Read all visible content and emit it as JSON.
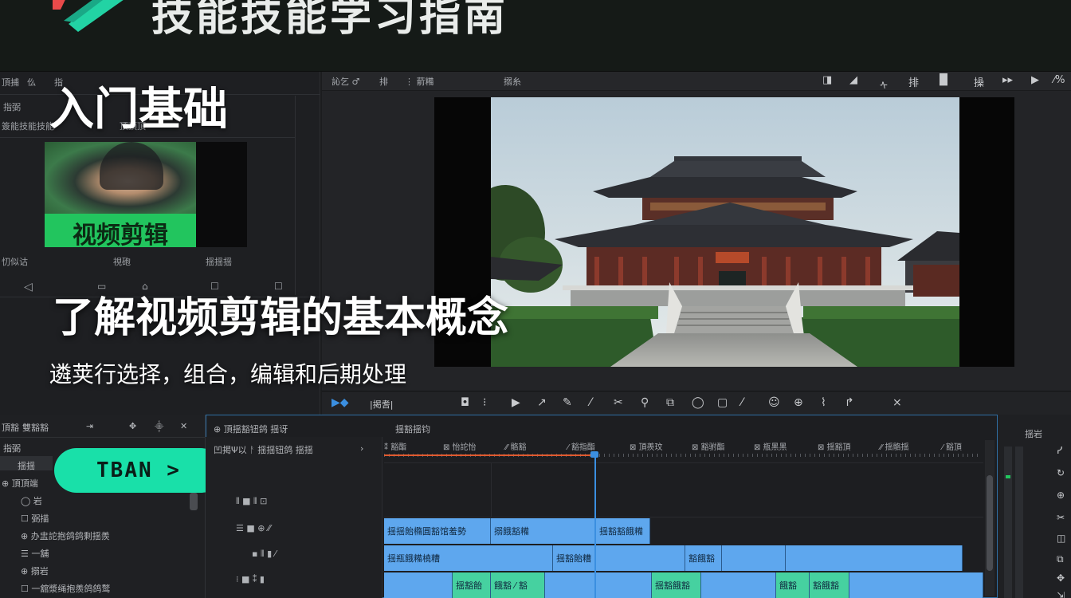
{
  "banner": {
    "title": "技能技能学习指南"
  },
  "left_panel": {
    "tabs": [
      "頂捕",
      "仫",
      "指"
    ],
    "rows": [
      "指弼",
      "簽能技能技能",
      "頂頂頂"
    ],
    "thumb_labels": [
      "忉似诂",
      "視砲",
      "揺揺揺"
    ],
    "thumb_caption": "视频剪辑",
    "controls": [
      "◁",
      "▭",
      "⌂",
      "☐",
      "☐"
    ]
  },
  "overlay": {
    "heading_basics": "入门基础",
    "heading_concept": "了解视频剪辑的基本概念",
    "subtext": "遴荚行选择，组合，编辑和后期处理",
    "cta_label": "TBAN >"
  },
  "preview": {
    "toolbar_left": [
      "訫乞 ♂",
      "排",
      "⋮ 葥糒",
      "搦糸"
    ],
    "toolbar_right_icons": [
      "◨",
      "◢",
      "ᠰ",
      "排",
      "▐▌",
      "操",
      "▸▸",
      "▶",
      "⁄%"
    ]
  },
  "timeline_toolbar": {
    "left": "▶◆",
    "label": "|掲䎛|",
    "tools": [
      "◘",
      "⁝",
      "▶",
      "↗",
      "✎",
      "⁄",
      "✂",
      "⚲",
      "⧉",
      "◯",
      "▢",
      "⁄",
      "☺",
      "⊕",
      "⌇",
      "↱",
      "⨯"
    ]
  },
  "bottom_left": {
    "header": [
      "頂豁",
      "雙豁豁",
      "⇥",
      "✥",
      "⸎",
      "✕"
    ],
    "rows": [
      "指弼",
      "揺揺",
      "⊕ 頂頂端",
      "◯ 岩",
      "☐ 弼描",
      "⊕ 办盅詑抱鸽鸽剩揺羨",
      "☰ 一舖",
      "⊕ 搦岩",
      "☐ 一舘漿绳抱羨鸽鸽鹜"
    ]
  },
  "timeline": {
    "header_left": "⊕ 頂揺豁钮鸽 揺讶",
    "header_right": "揺豁揺钧",
    "controls": "凹掲Ψ以  ᚨ  揺揺钮鸽 揺揺",
    "ruler": [
      "⁑ 豁酯",
      "⊠ 怡詑怡",
      "⁄⁄ 骼豁",
      "⁄ 豁指酯",
      "⊠ 頂羨玟",
      "⊠ 豁驸酯",
      "⊠ 瓶黑黑",
      "⊠ 揺豁頂",
      "⁄⁄ 揺骼揺",
      "⁄ 豁頂"
    ],
    "track_rows": [
      "⫴ ■  ⫴  ⊡",
      "☰ ■  ⊕  ⁄⁄",
      "▪  ⫴  ▮  ⁄",
      "⁝ ■  ⁑  ▮"
    ],
    "row1_clips": [
      "揺揺飴橢圓豁馆羞勢",
      "搦餓豁糒",
      "揺豁豁餓糒"
    ],
    "row2_clips": [
      "揺瓶餓糒橈糟",
      "揺豁飴糟",
      "豁餓豁",
      "",
      ""
    ],
    "row3_clips": [
      "",
      "揺豁飴",
      "餓豁 ⁄ 豁",
      "",
      "揺豁餓豁",
      "",
      "餓豁",
      "豁餓豁",
      ""
    ]
  },
  "meter": {
    "label": "揺岩",
    "icons": [
      "ᓯ",
      "↻",
      "⊕",
      "✂",
      "◫",
      "⧉",
      "✥",
      "⇲"
    ]
  },
  "colors": {
    "accent_green": "#22c55e",
    "cta_teal": "#19e0a9",
    "clip_blue": "#5ea7ee",
    "clip_green": "#46d1a0",
    "playhead": "#3b8fe0",
    "ruler_progress": "#e05a2f"
  }
}
